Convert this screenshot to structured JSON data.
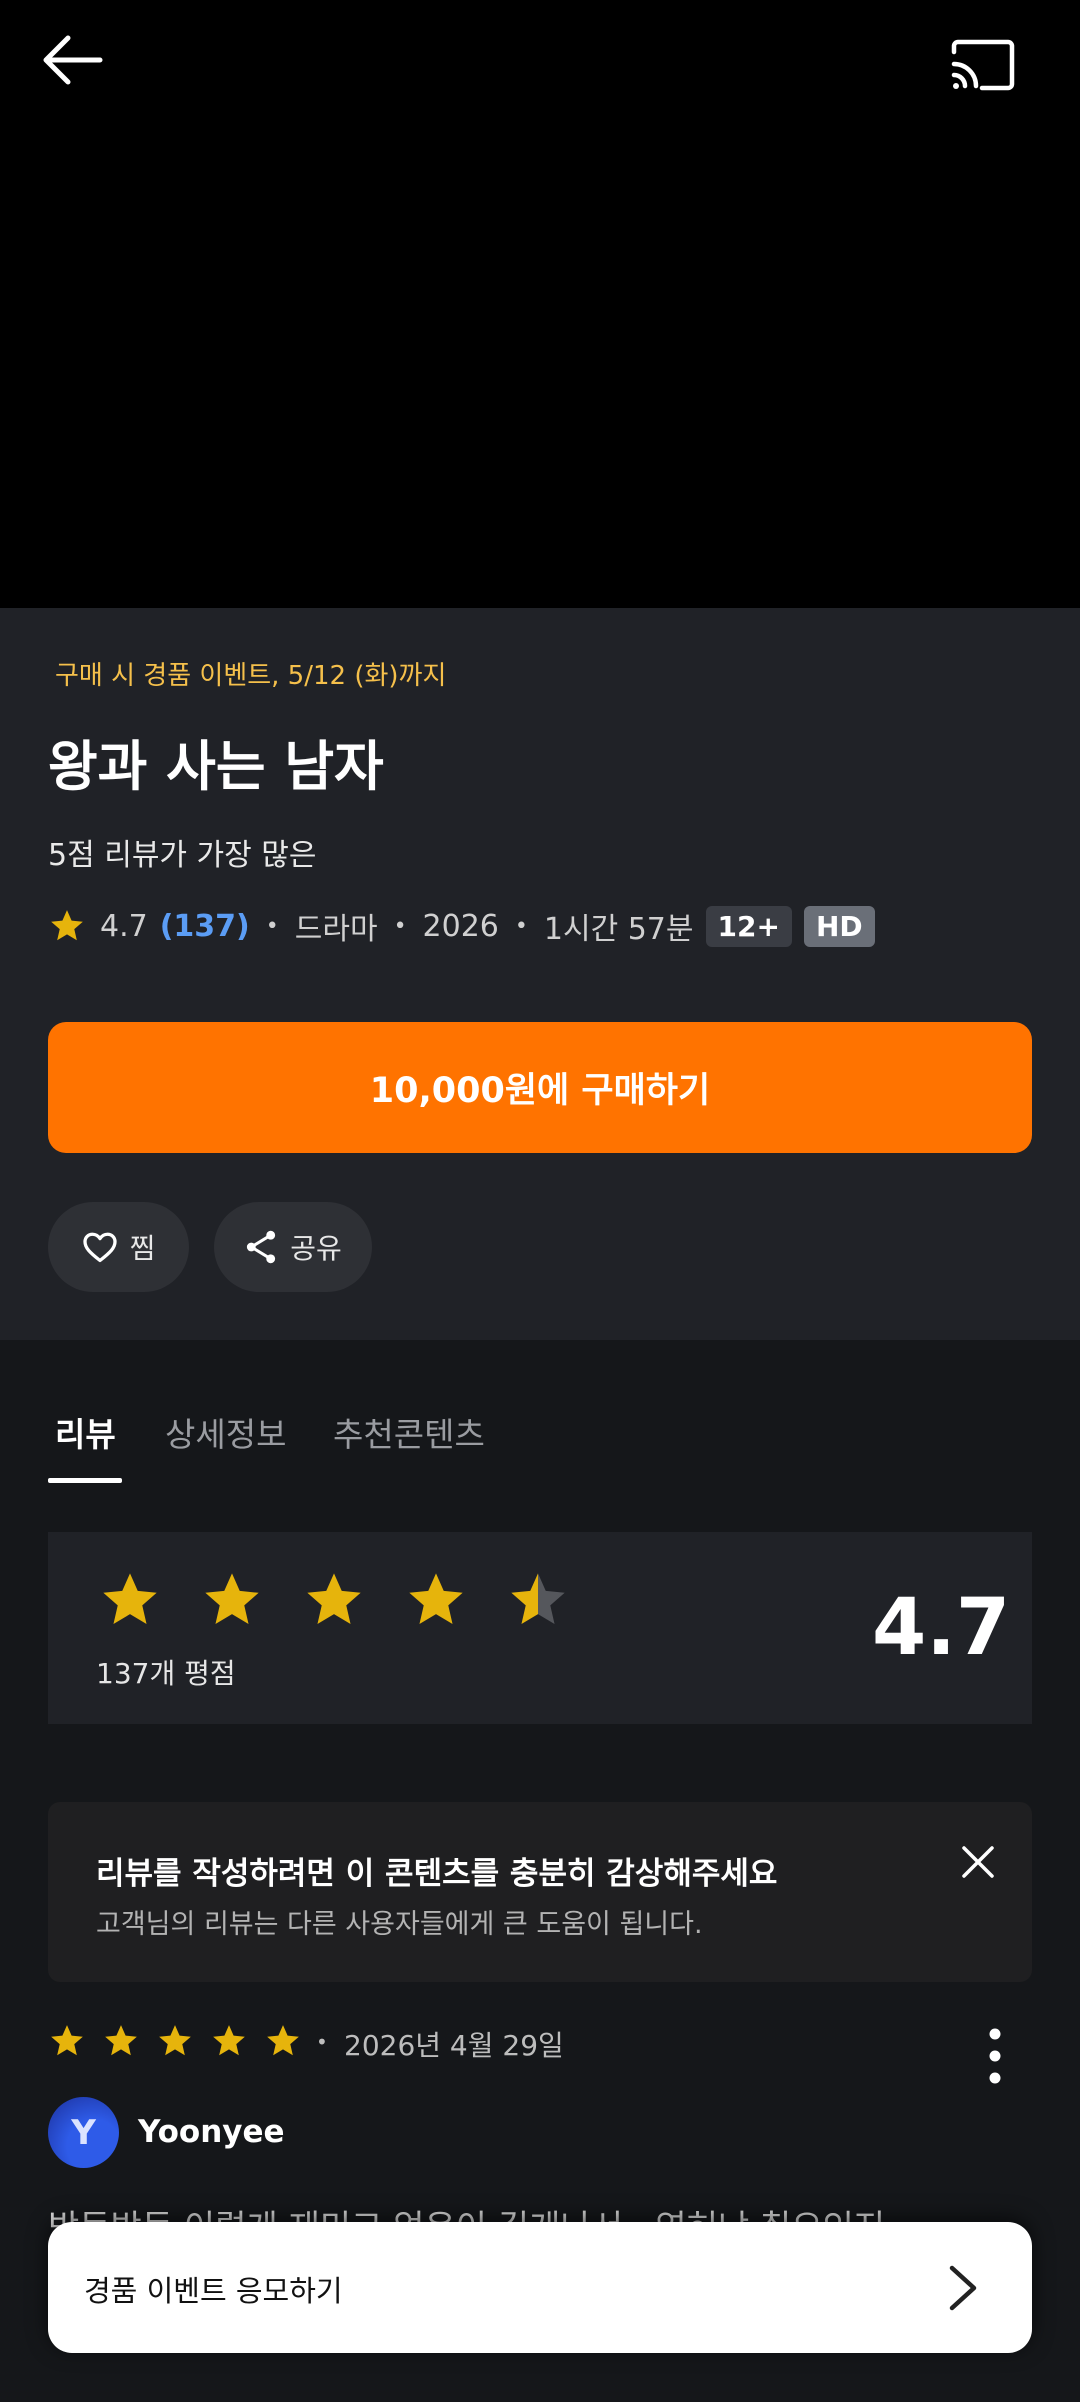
{
  "header": {
    "back_icon": "arrow-left-icon",
    "cast_icon": "cast-icon"
  },
  "info": {
    "event_text": "구매 시 경품 이벤트, 5/12 (화)까지",
    "title": "왕과 사는 남자",
    "subtitle": "5점 리뷰가 가장 많은",
    "rating": "4.7",
    "rating_count": "(137)",
    "genre": "드라마",
    "year": "2026",
    "runtime": "1시간 57분",
    "age_badge": "12+",
    "quality_badge": "HD",
    "buy_label": "10,000원에 구매하기",
    "like_label": "찜",
    "share_label": "공유"
  },
  "tabs": [
    {
      "label": "리뷰",
      "active": true
    },
    {
      "label": "상세정보",
      "active": false
    },
    {
      "label": "추천콘텐츠",
      "active": false
    }
  ],
  "rating_summary": {
    "stars": 4.5,
    "count_label": "137개 평점",
    "score": "4.7"
  },
  "notice": {
    "title": "리뷰를 작성하려면 이 콘텐츠를 충분히 감상해주세요",
    "subtitle": "고객님의 리뷰는 다른 사용자들에게 큰 도움이 됩니다."
  },
  "review": {
    "stars": 5,
    "date": "2026년 4월 29일",
    "avatar_initial": "Y",
    "username": "Yoonyee",
    "text": "박둥박둥 이렇게 재미고 없은이 길게나서...역허냐 칠요인지"
  },
  "bottom_card": {
    "label": "경품 이벤트 응모하기"
  },
  "colors": {
    "accent_orange": "#ff7300",
    "star_yellow": "#e6b40c",
    "event_yellow": "#f5c04b",
    "link_blue": "#5b9df5"
  }
}
